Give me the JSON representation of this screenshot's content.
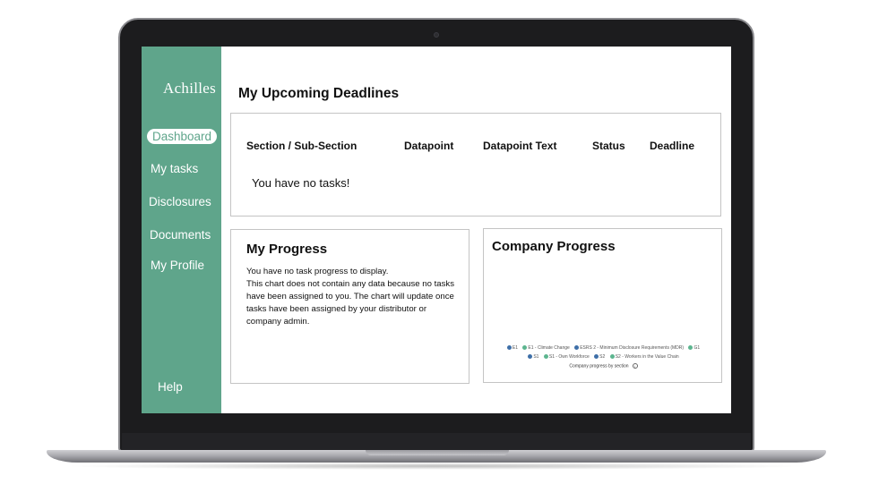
{
  "sidebar": {
    "logo": "Achilles",
    "items": [
      {
        "label": "Dashboard",
        "active": true
      },
      {
        "label": "My tasks"
      },
      {
        "label": "Disclosures"
      },
      {
        "label": "Documents"
      },
      {
        "label": "My Profile"
      }
    ],
    "help": "Help",
    "background_color": "#5fa58b"
  },
  "main": {
    "title": "My Upcoming Deadlines",
    "deadlines_table": {
      "columns": [
        "Section / Sub-Section",
        "Datapoint",
        "Datapoint Text",
        "Status",
        "Deadline"
      ],
      "empty_message": "You have no tasks!"
    },
    "my_progress": {
      "title": "My Progress",
      "lines": [
        "You have no task progress to display.",
        "This chart does not contain any data because no tasks have been assigned to you. The chart will update once tasks have been assigned by your distributor or company admin."
      ]
    },
    "company_progress": {
      "title": "Company Progress",
      "legend": [
        {
          "label": "E1",
          "color": "#3e6fa8"
        },
        {
          "label": "E1 - Climate Change",
          "color": "#5cb58f"
        },
        {
          "label": "ESRS 2 - Minimum Disclosure Requirements (MDR)",
          "color": "#3e6fa8"
        },
        {
          "label": "G1",
          "color": "#5cb58f"
        },
        {
          "label": "S1",
          "color": "#3e6fa8"
        },
        {
          "label": "S1 - Own Workforce",
          "color": "#5cb58f"
        },
        {
          "label": "S2",
          "color": "#3e6fa8"
        },
        {
          "label": "S2 - Workers in the Value Chain",
          "color": "#5cb58f"
        }
      ],
      "caption": "Company progress by section",
      "info_icon": "info-icon"
    }
  }
}
